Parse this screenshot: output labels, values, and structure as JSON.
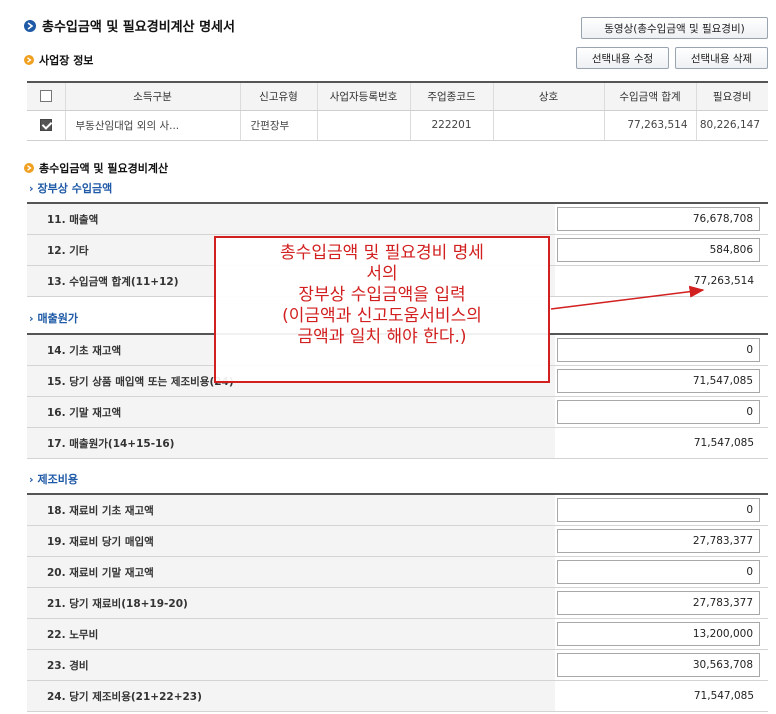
{
  "header": {
    "title": "총수입금액 및 필요경비계산 명세서",
    "video_button": "동영상(총수입금액 및 필요경비)",
    "edit_button": "선택내용 수정",
    "delete_button": "선택내용 삭제"
  },
  "business": {
    "title": "사업장 정보",
    "columns": [
      "소득구분",
      "신고유형",
      "사업자등록번호",
      "주업종코드",
      "상호",
      "수입금액 합계",
      "필요경비"
    ],
    "row": {
      "checked": true,
      "income_type": "부동산임대업 외의 사...",
      "report_type": "간편장부",
      "reg_no": "",
      "industry_code": "222201",
      "company": "",
      "revenue_total": "77,263,514",
      "expense": "80,226,147"
    }
  },
  "calc": {
    "title": "총수입금액 및 필요경비계산",
    "section_revenue": "장부상 수입금액",
    "section_cogs": "매출원가",
    "section_mfg": "제조비용",
    "rows_revenue": [
      {
        "label": "11. 매출액",
        "value": "76,678,708",
        "input": true
      },
      {
        "label": "12. 기타",
        "value": "584,806",
        "input": true
      },
      {
        "label": "13. 수입금액 합계(11+12)",
        "value": "77,263,514",
        "input": false
      }
    ],
    "rows_cogs": [
      {
        "label": "14. 기초 재고액",
        "value": "0",
        "input": true
      },
      {
        "label": "15. 당기 상품 매입액 또는 제조비용(24)",
        "value": "71,547,085",
        "input": true
      },
      {
        "label": "16. 기말 재고액",
        "value": "0",
        "input": true
      },
      {
        "label": "17. 매출원가(14+15-16)",
        "value": "71,547,085",
        "input": false
      }
    ],
    "rows_mfg": [
      {
        "label": "18. 재료비 기초 재고액",
        "value": "0",
        "input": true
      },
      {
        "label": "19. 재료비 당기 매입액",
        "value": "27,783,377",
        "input": true
      },
      {
        "label": "20. 재료비 기말 재고액",
        "value": "0",
        "input": true
      },
      {
        "label": "21. 당기 재료비(18+19-20)",
        "value": "27,783,377",
        "input": true
      },
      {
        "label": "22. 노무비",
        "value": "13,200,000",
        "input": true
      },
      {
        "label": "23. 경비",
        "value": "30,563,708",
        "input": true
      },
      {
        "label": "24. 당기 제조비용(21+22+23)",
        "value": "71,547,085",
        "input": false
      }
    ]
  },
  "annotation": {
    "lines": [
      "총수입금액 및 필요경비 명세",
      "서의",
      "장부상 수입금액을 입력",
      "(이금액과 신고도움서비스의",
      "금액과 일치 해야 한다.)"
    ],
    "color": "#d21f1f"
  },
  "colors": {
    "accent": "#1f5aa6",
    "bullet": "#f0a020"
  }
}
